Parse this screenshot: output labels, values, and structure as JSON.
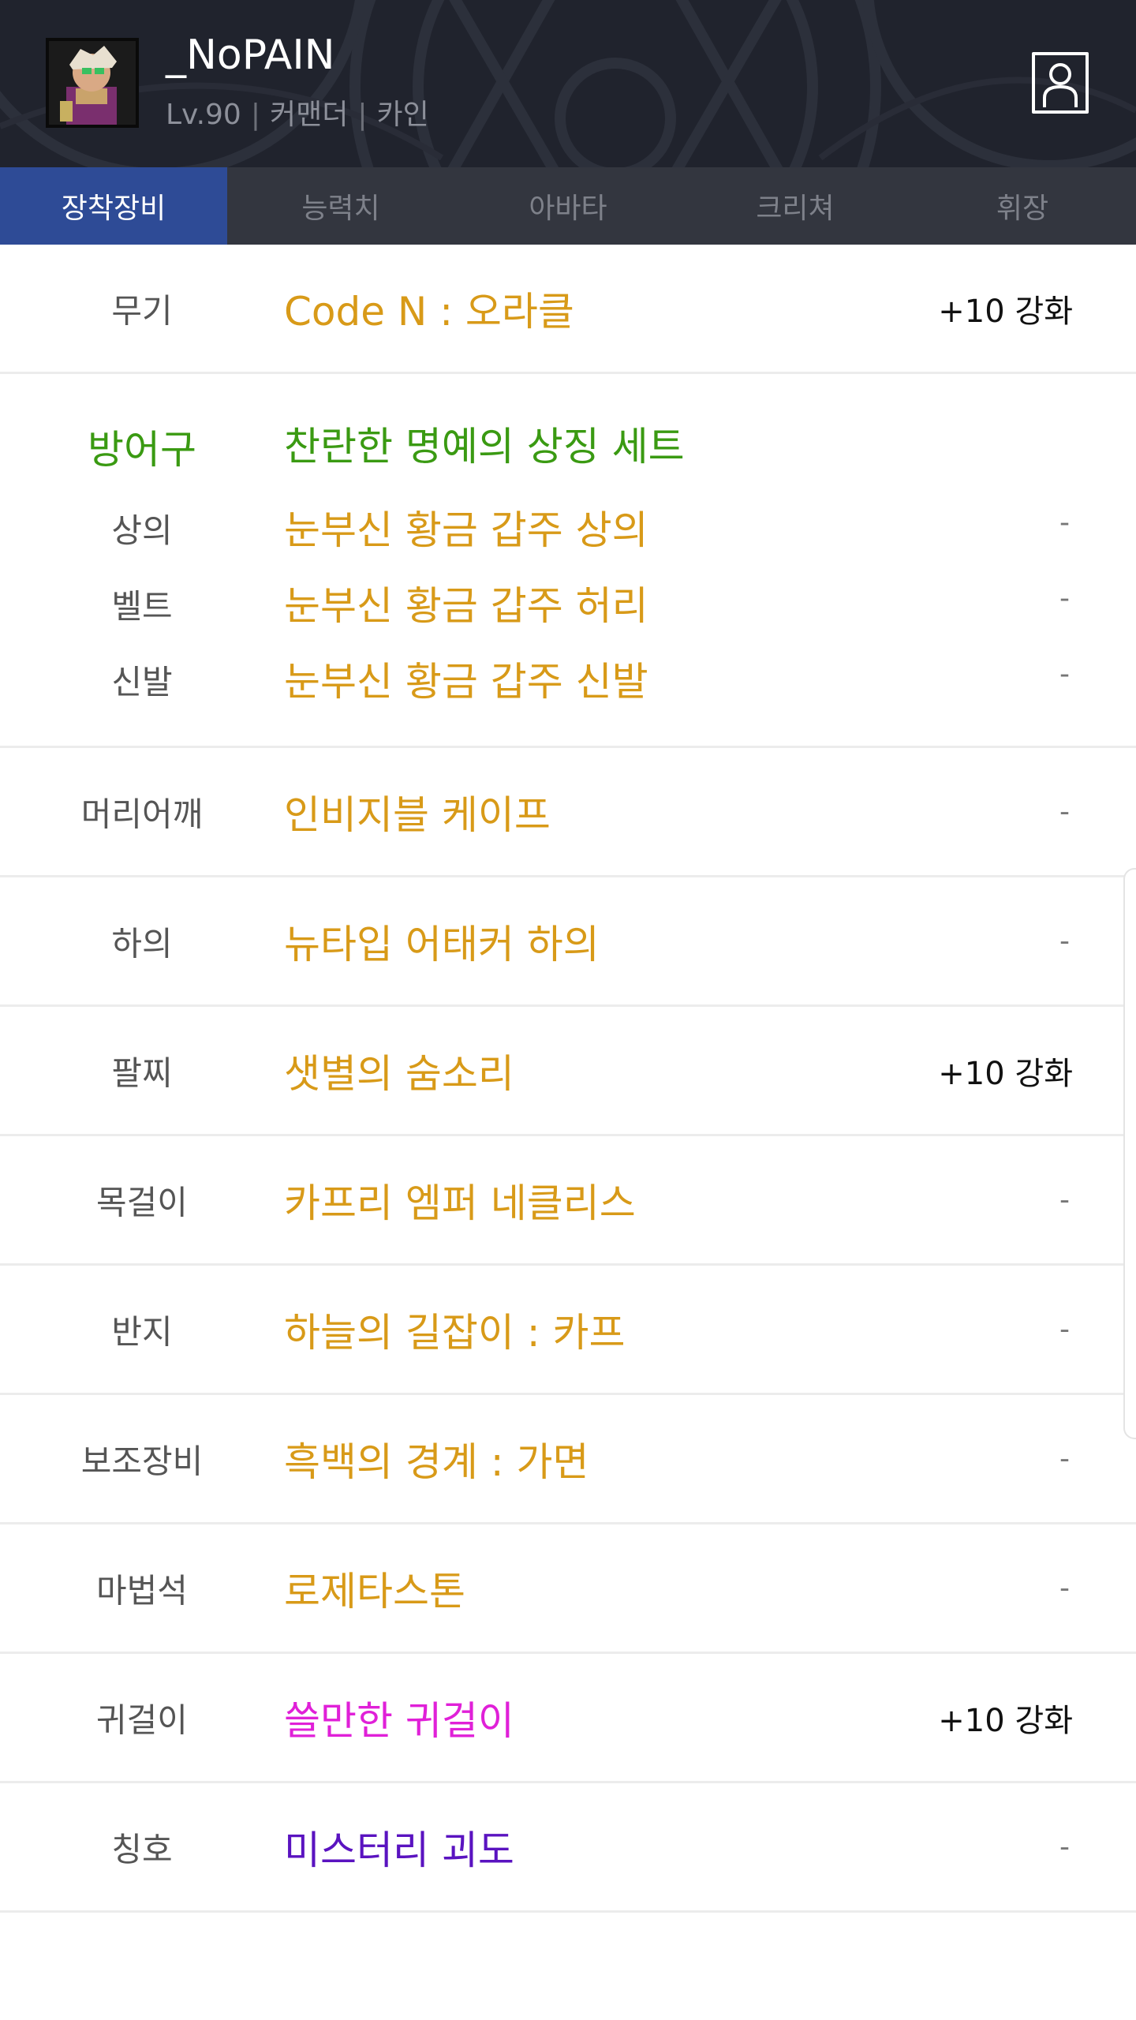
{
  "profile": {
    "name": "_NoPAIN",
    "level": "Lv.90",
    "job": "커맨더",
    "server": "카인",
    "separator": "|",
    "avatar_icon": "character-portrait-icon",
    "profile_icon": "user-profile-icon"
  },
  "tabs": [
    {
      "label": "장착장비",
      "active": true
    },
    {
      "label": "능력치",
      "active": false
    },
    {
      "label": "아바타",
      "active": false
    },
    {
      "label": "크리쳐",
      "active": false
    },
    {
      "label": "휘장",
      "active": false
    }
  ],
  "colors": {
    "header_bg": "#222530",
    "tab_bar_bg": "#33363f",
    "tab_active_bg": "#2e4b96",
    "epic": "#d89a18",
    "set": "#3a9a12",
    "legendary": "#e020d8",
    "unique": "#5a13c0"
  },
  "equipment": {
    "weapon": {
      "slot": "무기",
      "item": "Code N : 오라클",
      "enhance": "+10 강화"
    },
    "armor": {
      "set_slot": "방어구",
      "set_name": "찬란한 명예의 상징 세트",
      "pieces": [
        {
          "slot": "상의",
          "item": "눈부신 황금 갑주 상의",
          "enhance": "-"
        },
        {
          "slot": "벨트",
          "item": "눈부신 황금 갑주 허리",
          "enhance": "-"
        },
        {
          "slot": "신발",
          "item": "눈부신 황금 갑주 신발",
          "enhance": "-"
        }
      ]
    },
    "rows": [
      {
        "slot": "머리어깨",
        "item": "인비지블 케이프",
        "enhance": "-",
        "rarity": "epic"
      },
      {
        "slot": "하의",
        "item": "뉴타입 어태커 하의",
        "enhance": "-",
        "rarity": "epic"
      },
      {
        "slot": "팔찌",
        "item": "샛별의 숨소리",
        "enhance": "+10 강화",
        "rarity": "epic"
      },
      {
        "slot": "목걸이",
        "item": "카프리 엠퍼 네클리스",
        "enhance": "-",
        "rarity": "epic"
      },
      {
        "slot": "반지",
        "item": "하늘의 길잡이 : 카프",
        "enhance": "-",
        "rarity": "epic"
      },
      {
        "slot": "보조장비",
        "item": "흑백의 경계 : 가면",
        "enhance": "-",
        "rarity": "epic"
      },
      {
        "slot": "마법석",
        "item": "로제타스톤",
        "enhance": "-",
        "rarity": "epic"
      },
      {
        "slot": "귀걸이",
        "item": "쓸만한 귀걸이",
        "enhance": "+10 강화",
        "rarity": "legendary"
      },
      {
        "slot": "칭호",
        "item": "미스터리 괴도",
        "enhance": "-",
        "rarity": "unique"
      }
    ]
  }
}
